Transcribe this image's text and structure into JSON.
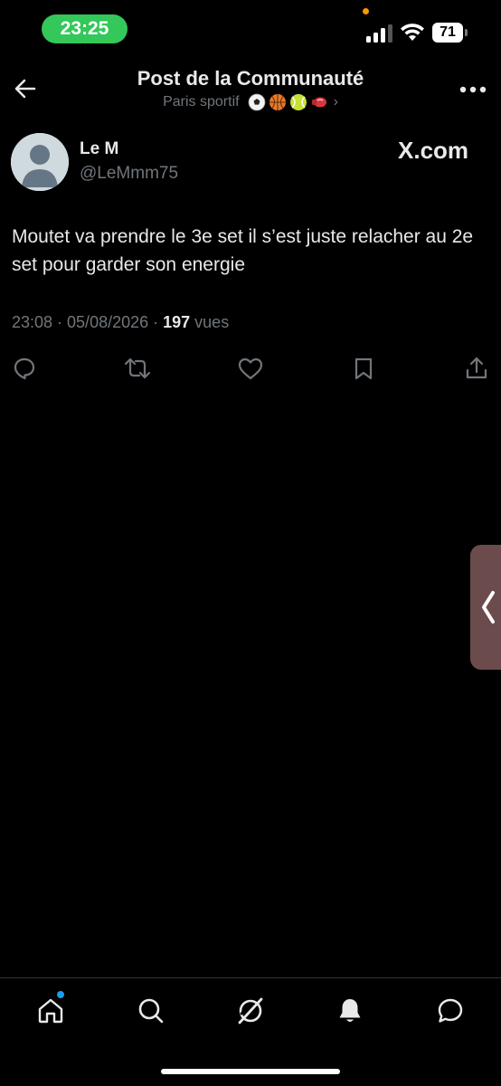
{
  "status_bar": {
    "time": "23:25",
    "battery": "71"
  },
  "header": {
    "title": "Post de la Communauté",
    "subtitle": "Paris sportif",
    "subtitle_chevron": "›",
    "back_icon": "arrow-left-icon",
    "more_icon": "more-horizontal-icon"
  },
  "post": {
    "display_name": "Le M",
    "handle": "@LeMmm75",
    "watermark": "X.com",
    "text": "Moutet va prendre le 3e set il s’est juste relacher au 2e set pour garder son energie",
    "timestamp": "23:08 · 05/08/2026 · ",
    "views_count": "197",
    "views_label": " vues",
    "actions": [
      "reply-icon",
      "repost-icon",
      "like-icon",
      "bookmark-icon",
      "share-icon"
    ]
  },
  "bottom_nav": {
    "items": [
      "home-icon",
      "search-icon",
      "grok-icon",
      "notifications-icon",
      "messages-icon"
    ]
  },
  "colors": {
    "background": "#000000",
    "text_primary": "#e7e9ea",
    "text_secondary": "#71767b",
    "status_green": "#34c759",
    "accent_blue": "#1d9bf0"
  }
}
